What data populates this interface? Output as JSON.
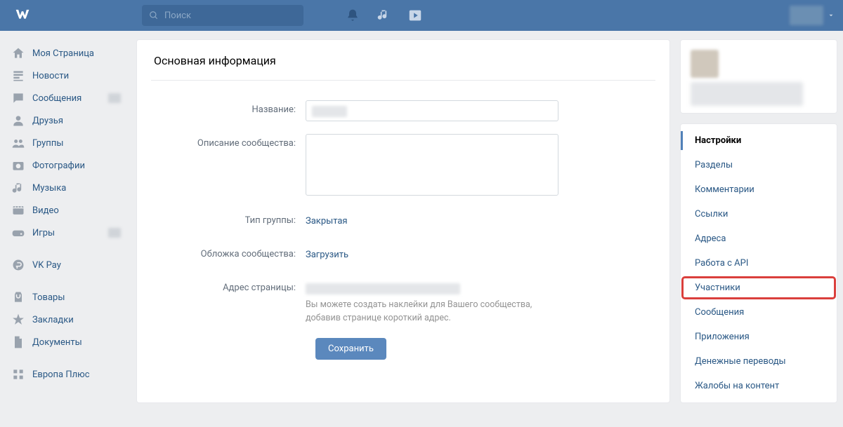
{
  "header": {
    "search_placeholder": "Поиск"
  },
  "sidebar": {
    "items": [
      {
        "icon": "home",
        "label": "Моя Страница"
      },
      {
        "icon": "news",
        "label": "Новости"
      },
      {
        "icon": "msg",
        "label": "Сообщения",
        "blur": true
      },
      {
        "icon": "friends",
        "label": "Друзья"
      },
      {
        "icon": "groups",
        "label": "Группы"
      },
      {
        "icon": "photos",
        "label": "Фотографии"
      },
      {
        "icon": "music",
        "label": "Музыка"
      },
      {
        "icon": "video",
        "label": "Видео"
      },
      {
        "icon": "games",
        "label": "Игры",
        "blur": true
      }
    ],
    "items2": [
      {
        "icon": "pay",
        "label": "VK Pay"
      }
    ],
    "items3": [
      {
        "icon": "shop",
        "label": "Товары"
      },
      {
        "icon": "star",
        "label": "Закладки"
      },
      {
        "icon": "docs",
        "label": "Документы"
      }
    ],
    "items4": [
      {
        "icon": "grid",
        "label": "Европа Плюс"
      }
    ]
  },
  "main": {
    "title": "Основная информация",
    "labels": {
      "name": "Название:",
      "desc": "Описание сообщества:",
      "type": "Тип группы:",
      "cover": "Обложка сообщества:",
      "addr": "Адрес страницы:"
    },
    "values": {
      "type": "Закрытая",
      "cover": "Загрузить"
    },
    "hint": "Вы можете создать наклейки для Вашего сообщества, добавив странице короткий адрес.",
    "save": "Сохранить"
  },
  "rightmenu": [
    {
      "label": "Настройки",
      "active": true
    },
    {
      "label": "Разделы"
    },
    {
      "label": "Комментарии"
    },
    {
      "label": "Ссылки"
    },
    {
      "label": "Адреса"
    },
    {
      "label": "Работа с API"
    },
    {
      "label": "Участники",
      "highlighted": true
    },
    {
      "label": "Сообщения"
    },
    {
      "label": "Приложения"
    },
    {
      "label": "Денежные переводы"
    },
    {
      "label": "Жалобы на контент"
    }
  ]
}
